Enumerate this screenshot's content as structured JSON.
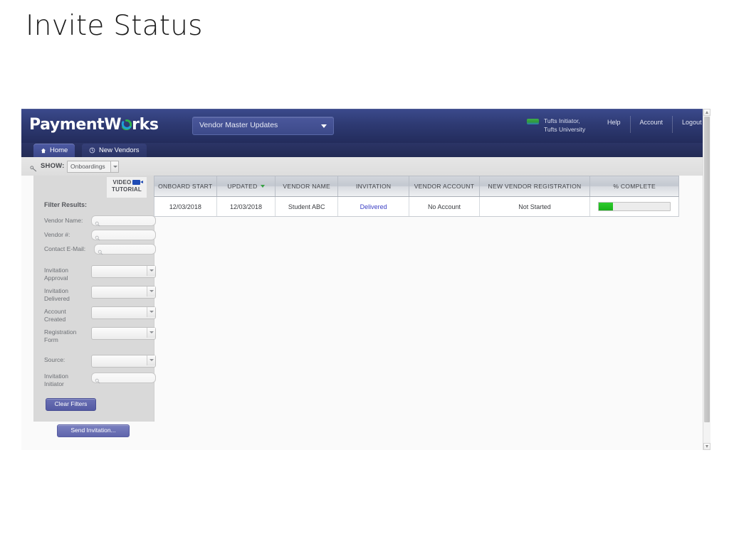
{
  "slide": {
    "title": "Invite Status"
  },
  "app": {
    "logo_before": "PaymentW",
    "logo_after": "rks",
    "logo_mark_icon": "paymentworks-swirl-icon",
    "context_select": {
      "value": "Vendor Master Updates",
      "caret_icon": "chevron-down-icon"
    },
    "user": {
      "icon": "user-bar-icon",
      "name": "Tufts Initiator,",
      "org": "Tufts University"
    },
    "links": [
      {
        "label": "Help"
      },
      {
        "label": "Account"
      },
      {
        "label": "Logout"
      }
    ],
    "tabs": [
      {
        "label": "Home",
        "icon": "home-icon",
        "active": true
      },
      {
        "label": "New Vendors",
        "icon": "clock-icon",
        "active": false
      }
    ]
  },
  "show_bar": {
    "icon": "filter-icon",
    "label": "SHOW:",
    "select_value": "Onboardings",
    "caret_icon": "chevron-down-icon"
  },
  "filter_panel": {
    "video_tutorial": {
      "line1": "VIDEO",
      "line2": "TUTORIAL",
      "icon": "video-camera-icon"
    },
    "title": "Filter Results:",
    "text_fields": [
      {
        "label": "Vendor Name:",
        "value": "",
        "placeholder": "",
        "icon": "search-icon"
      },
      {
        "label": "Vendor #:",
        "value": "",
        "placeholder": "",
        "icon": "search-icon"
      },
      {
        "label": "Contact E-Mail:",
        "value": "",
        "placeholder": "",
        "icon": "search-icon"
      }
    ],
    "selects": [
      {
        "label": "Invitation Approval",
        "value": ""
      },
      {
        "label": "Invitation Delivered",
        "value": ""
      },
      {
        "label": "Account Created",
        "value": ""
      },
      {
        "label": "Registration Form",
        "value": ""
      },
      {
        "label": "Source:",
        "value": ""
      }
    ],
    "initiator_field": {
      "label": "Invitation Initiator",
      "value": "",
      "icon": "search-icon"
    },
    "clear_button": "Clear Filters",
    "send_button": "Send Invitation..."
  },
  "table": {
    "columns": [
      {
        "label": "ONBOARD START",
        "sorted": false
      },
      {
        "label": "UPDATED",
        "sorted": true,
        "sort_icon": "sort-desc-icon"
      },
      {
        "label": "VENDOR NAME",
        "sorted": false
      },
      {
        "label": "INVITATION",
        "sorted": false
      },
      {
        "label": "VENDOR ACCOUNT",
        "sorted": false
      },
      {
        "label": "NEW VENDOR REGISTRATION",
        "sorted": false
      },
      {
        "label": "% COMPLETE",
        "sorted": false
      }
    ],
    "rows": [
      {
        "onboard_start": "12/03/2018",
        "updated": "12/03/2018",
        "vendor_name": "Student ABC",
        "invitation": "Delivered",
        "vendor_account": "No Account",
        "registration": "Not Started",
        "percent_complete": 20
      }
    ]
  },
  "scrollbar": {
    "up_icon": "scroll-up-arrow-icon",
    "down_icon": "scroll-down-arrow-icon"
  },
  "colors": {
    "header_blue": "#2e3a73",
    "accent_purple": "#545aa3",
    "link_blue": "#3b3fc4",
    "progress_green": "#19b019",
    "sort_green": "#36a043"
  }
}
